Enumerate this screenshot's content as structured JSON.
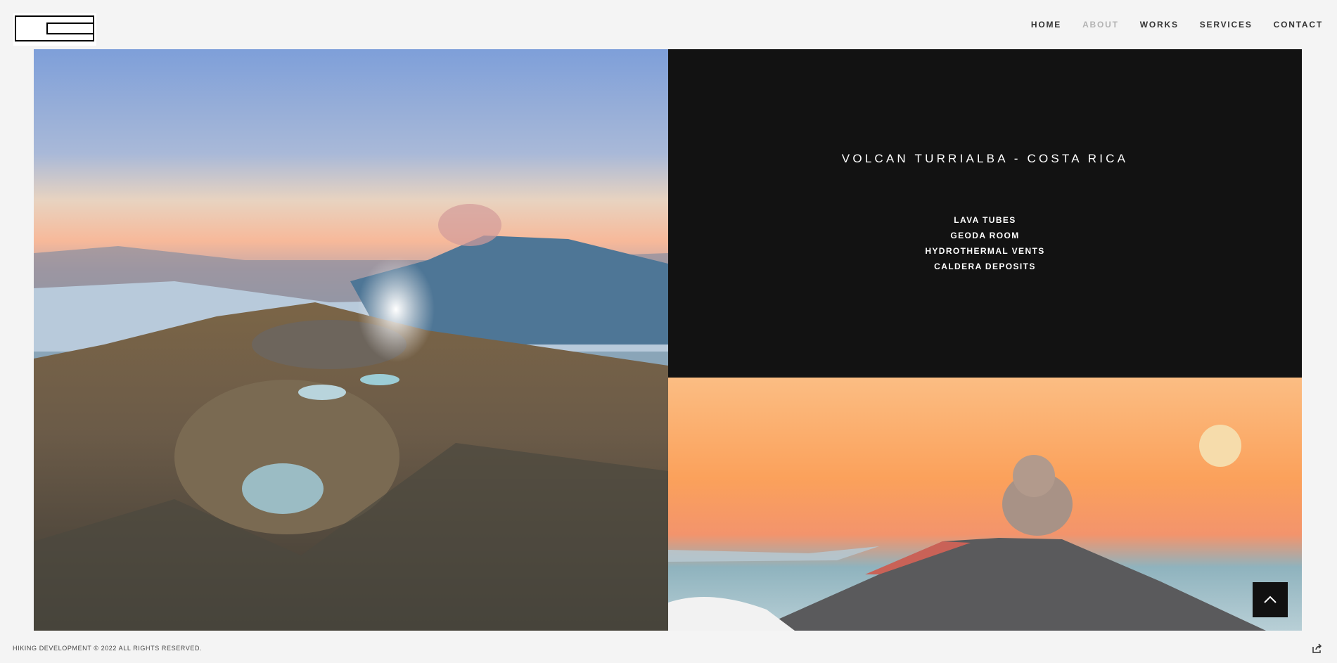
{
  "header": {
    "logo_name": "brand-logo"
  },
  "nav": {
    "items": [
      {
        "label": "HOME",
        "active": false
      },
      {
        "label": "ABOUT",
        "active": true
      },
      {
        "label": "WORKS",
        "active": false
      },
      {
        "label": "SERVICES",
        "active": false
      },
      {
        "label": "CONTACT",
        "active": false
      }
    ]
  },
  "info": {
    "title": "VOLCAN TURRIALBA - COSTA RICA",
    "features": [
      "LAVA TUBES",
      "GEODA ROOM",
      "HYDROTHERMAL VENTS",
      "CALDERA DEPOSITS"
    ]
  },
  "footer": {
    "copyright": "HIKING DEVELOPMENT © 2022 ALL RIGHTS RESERVED."
  },
  "icons": {
    "scroll_top": "chevron-up-icon",
    "share": "share-icon"
  },
  "colors": {
    "background": "#f4f4f4",
    "panel": "#121212",
    "nav_active": "#b3b3b3",
    "nav_text": "#333333"
  }
}
